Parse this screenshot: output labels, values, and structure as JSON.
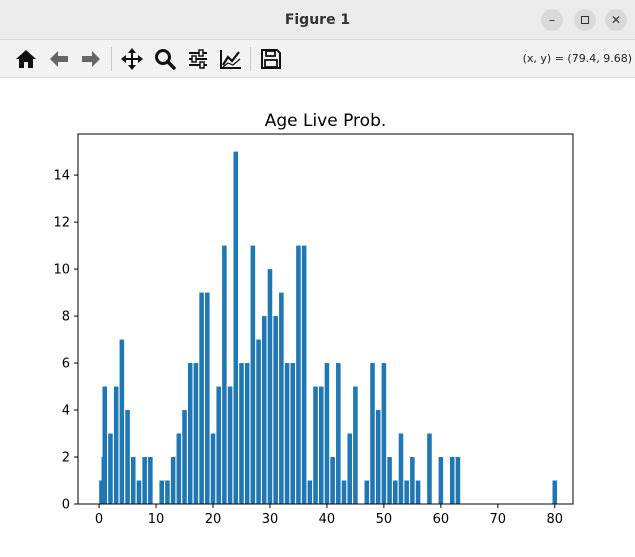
{
  "window": {
    "title": "Figure 1"
  },
  "toolbar": {
    "buttons": [
      "home-icon",
      "back-icon",
      "forward-icon",
      "pan-icon",
      "zoom-icon",
      "configure-subplots-icon",
      "edit-axes-icon",
      "save-icon"
    ],
    "coords": "(x, y) = (79.4, 9.68)"
  },
  "colors": {
    "bar": "#1f77b4"
  },
  "chart_data": {
    "type": "bar",
    "title": "Age Live Prob.",
    "xlabel": "",
    "ylabel": "",
    "xlim": [
      -3.7,
      83.2
    ],
    "ylim": [
      0,
      15.75
    ],
    "xticks": [
      0,
      10,
      20,
      30,
      40,
      50,
      60,
      70,
      80
    ],
    "yticks": [
      0,
      2,
      4,
      6,
      8,
      10,
      12,
      14
    ],
    "bar_width": 0.8,
    "x": [
      0.42,
      0.67,
      0.75,
      0.83,
      0.92,
      1,
      2,
      3,
      4,
      5,
      6,
      7,
      8,
      9,
      11,
      12,
      13,
      14,
      15,
      16,
      17,
      18,
      19,
      20,
      21,
      22,
      23,
      24,
      25,
      26,
      27,
      28,
      29,
      30,
      31,
      32,
      33,
      34,
      35,
      36,
      37,
      38,
      39,
      40,
      41,
      42,
      43,
      44,
      45,
      47,
      48,
      49,
      50,
      51,
      52,
      53,
      54,
      55,
      56,
      58,
      60,
      62,
      63,
      80
    ],
    "values": [
      1,
      1,
      1,
      2,
      2,
      5,
      3,
      5,
      7,
      4,
      2,
      1,
      2,
      2,
      1,
      1,
      2,
      3,
      4,
      6,
      6,
      9,
      9,
      3,
      5,
      11,
      5,
      15,
      6,
      6,
      11,
      7,
      8,
      10,
      8,
      9,
      6,
      6,
      11,
      11,
      1,
      5,
      5,
      6,
      2,
      6,
      1,
      3,
      5,
      1,
      6,
      4,
      6,
      2,
      1,
      3,
      1,
      2,
      1,
      3,
      2,
      2,
      2,
      1
    ]
  }
}
